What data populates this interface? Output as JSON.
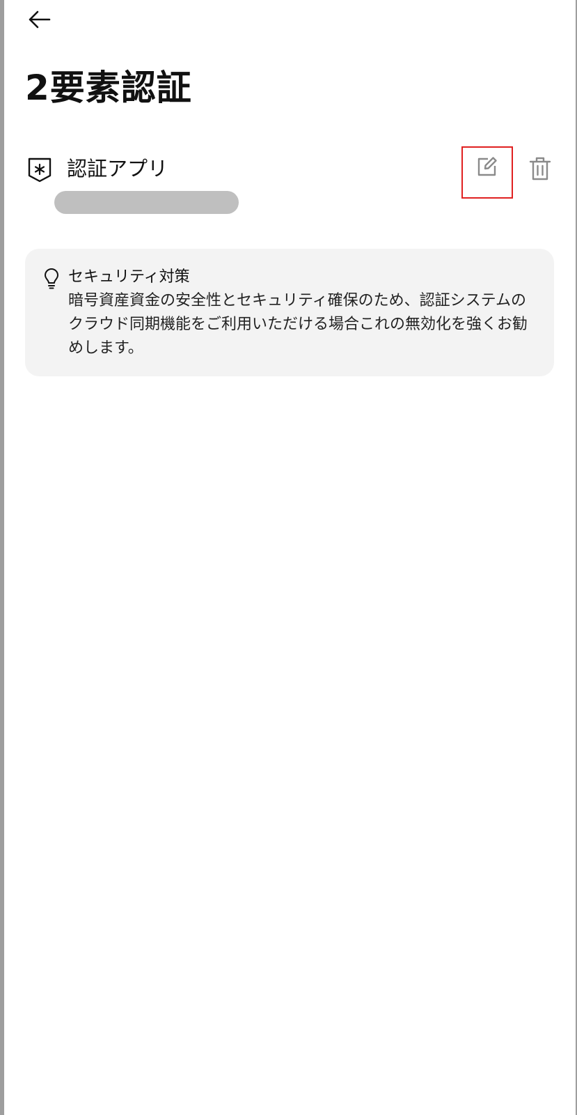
{
  "header": {
    "back_icon": "arrow-left-icon",
    "title": "2要素認証"
  },
  "method": {
    "icon": "shield-asterisk-icon",
    "label": "認証アプリ",
    "edit_icon": "edit-icon",
    "delete_icon": "trash-icon"
  },
  "tip": {
    "icon": "lightbulb-icon",
    "title": "セキュリティ対策",
    "body": "暗号資産資金の安全性とセキュリティ確保のため、認証システムのクラウド同期機能をご利用いただける場合これの無効化を強くお勧めします。"
  },
  "colors": {
    "highlight_border": "#e02020",
    "card_background": "#f3f3f3",
    "redacted_bar": "#bfbfbf",
    "icon_gray": "#8a8a8a"
  }
}
